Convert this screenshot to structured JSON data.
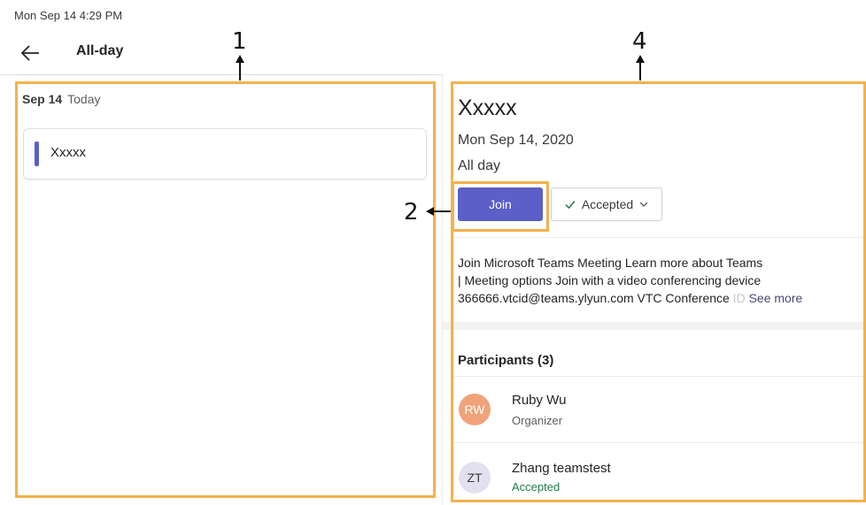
{
  "status_bar": {
    "datetime": "Mon Sep 14  4:29 PM"
  },
  "header": {
    "title": "All-day",
    "back_icon": "arrow-left-icon"
  },
  "agenda": {
    "date": "Sep 14",
    "date_label": "Today",
    "events": [
      {
        "title": "Xxxxx",
        "color": "#5b5fc7"
      }
    ]
  },
  "details": {
    "title": "Xxxxx",
    "date": "Mon Sep 14, 2020",
    "time": "All day",
    "join_label": "Join",
    "rsvp_label": "Accepted",
    "description_line1": "Join Microsoft Teams Meeting Learn more about Teams",
    "description_line2": "| Meeting options Join with a video conferencing device",
    "description_line3": "366666.vtcid@teams.ylyun.com VTC Conference",
    "description_fade": " ID",
    "see_more": "See more",
    "participants_heading": "Participants (3)",
    "participants": [
      {
        "initials": "RW",
        "name": "Ruby Wu",
        "role": "Organizer",
        "avatar_bg": "#f0a37a",
        "avatar_fg": "#ffffff",
        "role_color": "#605e5c"
      },
      {
        "initials": "ZT",
        "name": "Zhang teamstest",
        "role": "Accepted",
        "avatar_bg": "#e3e0ef",
        "avatar_fg": "#3b3a39",
        "role_color": "#237b4b"
      }
    ]
  },
  "annotations": {
    "label_1": "1",
    "label_2": "2",
    "label_4": "4",
    "color": "#f5b14c"
  },
  "colors": {
    "accent": "#5b5fc7",
    "accepted_check": "#237b4b"
  }
}
